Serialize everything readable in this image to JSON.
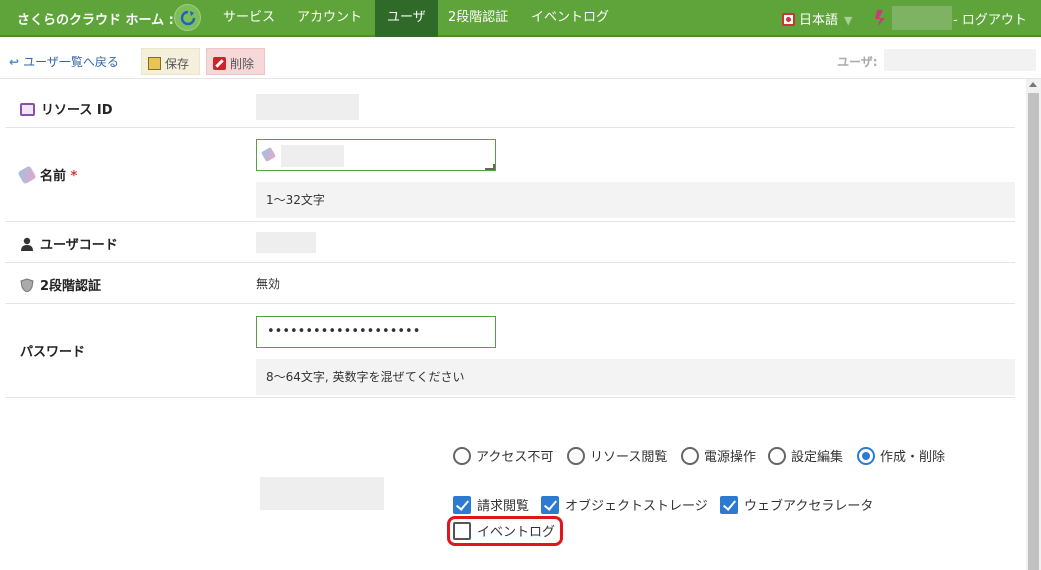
{
  "nav": {
    "brand": "さくらのクラウド ホーム :",
    "items": [
      {
        "label": "サービス",
        "active": false
      },
      {
        "label": "アカウント",
        "active": false
      },
      {
        "label": "ユーザ",
        "active": true
      },
      {
        "label": "2段階認証",
        "active": false
      },
      {
        "label": "イベントログ",
        "active": false
      }
    ],
    "language": "日本語",
    "logout": "- ログアウト"
  },
  "toolbar": {
    "back_label": "ユーザ一覧へ戻る",
    "save_label": "保存",
    "delete_label": "削除",
    "user_label": "ユーザ:"
  },
  "form": {
    "resource_id_label": "リソース ID",
    "name_label": "名前",
    "name_required": "*",
    "name_hint": "1〜32文字",
    "user_code_label": "ユーザコード",
    "two_factor_label": "2段階認証",
    "two_factor_value": "無効",
    "password_label": "パスワード",
    "password_value": "••••••••••••••••••••",
    "password_hint": "8〜64文字, 英数字を混ぜてください"
  },
  "permissions": {
    "radios": [
      {
        "label": "アクセス不可",
        "selected": false
      },
      {
        "label": "リソース閲覧",
        "selected": false
      },
      {
        "label": "電源操作",
        "selected": false
      },
      {
        "label": "設定編集",
        "selected": false
      },
      {
        "label": "作成・削除",
        "selected": true
      }
    ],
    "checkboxes": [
      {
        "label": "請求閲覧",
        "checked": true
      },
      {
        "label": "オブジェクトストレージ",
        "checked": true
      },
      {
        "label": "ウェブアクセラレータ",
        "checked": true
      },
      {
        "label": "イベントログ",
        "checked": false
      }
    ]
  },
  "colors": {
    "nav_bg": "#5ea43b",
    "nav_active": "#2f6a28",
    "accent_blue": "#2d7bd1",
    "highlight_red": "#e0161b"
  }
}
